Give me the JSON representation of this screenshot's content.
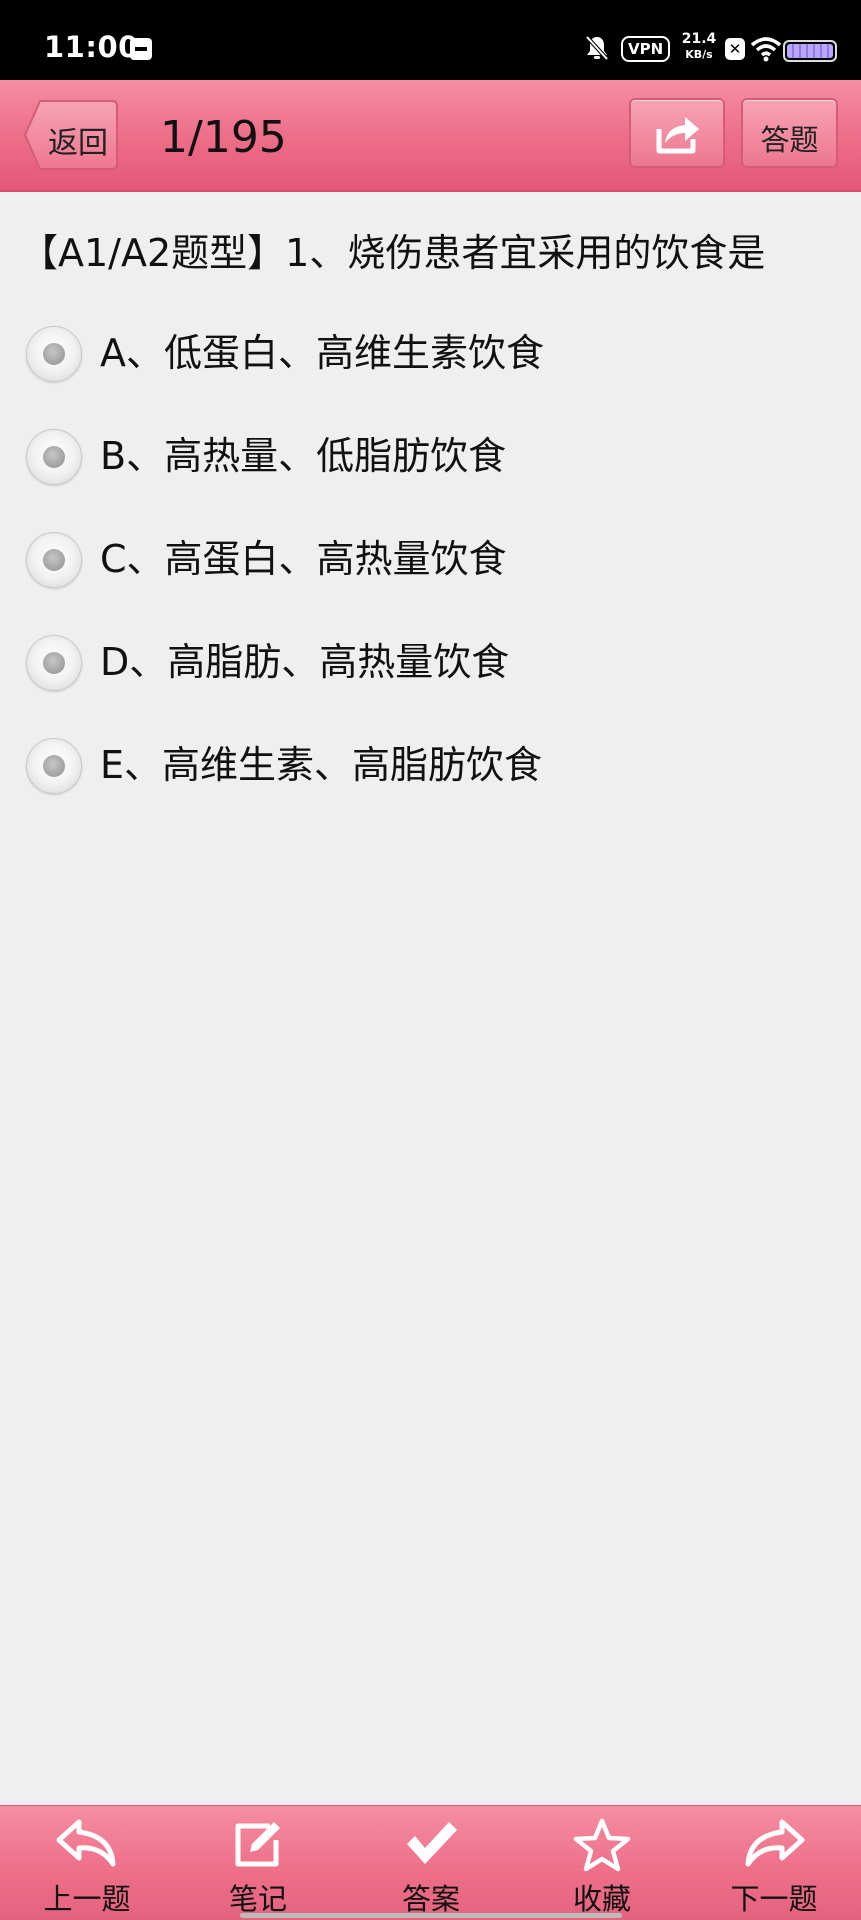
{
  "status_bar": {
    "time": "11:00",
    "vpn_label": "VPN",
    "speed_value": "21.4",
    "speed_unit": "KB/s",
    "x_badge": "✕",
    "icons": [
      "sim-card-icon",
      "mute-icon",
      "vpn-icon",
      "x-icon",
      "wifi-icon",
      "battery-icon"
    ]
  },
  "header": {
    "back_label": "返回",
    "question_counter": "1/195",
    "answer_label": "答题",
    "share_icon": "share-icon"
  },
  "question": {
    "stem": "【A1/A2题型】1、烧伤患者宜采用的饮食是",
    "options": [
      {
        "label": "A、低蛋白、高维生素饮食",
        "selected": false
      },
      {
        "label": "B、高热量、低脂肪饮食",
        "selected": false
      },
      {
        "label": "C、高蛋白、高热量饮食",
        "selected": false
      },
      {
        "label": "D、高脂肪、高热量饮食",
        "selected": false
      },
      {
        "label": "E、高维生素、高脂肪饮食",
        "selected": false
      }
    ]
  },
  "toolbar": {
    "items": [
      {
        "label": "上一题",
        "icon": "previous-arrow-icon"
      },
      {
        "label": "笔记",
        "icon": "note-edit-icon"
      },
      {
        "label": "答案",
        "icon": "checkmark-icon"
      },
      {
        "label": "收藏",
        "icon": "star-icon"
      },
      {
        "label": "下一题",
        "icon": "next-arrow-icon"
      }
    ]
  },
  "colors": {
    "accent_pink": "#ee6f89",
    "background": "#efefef",
    "status_bar": "#000000"
  }
}
